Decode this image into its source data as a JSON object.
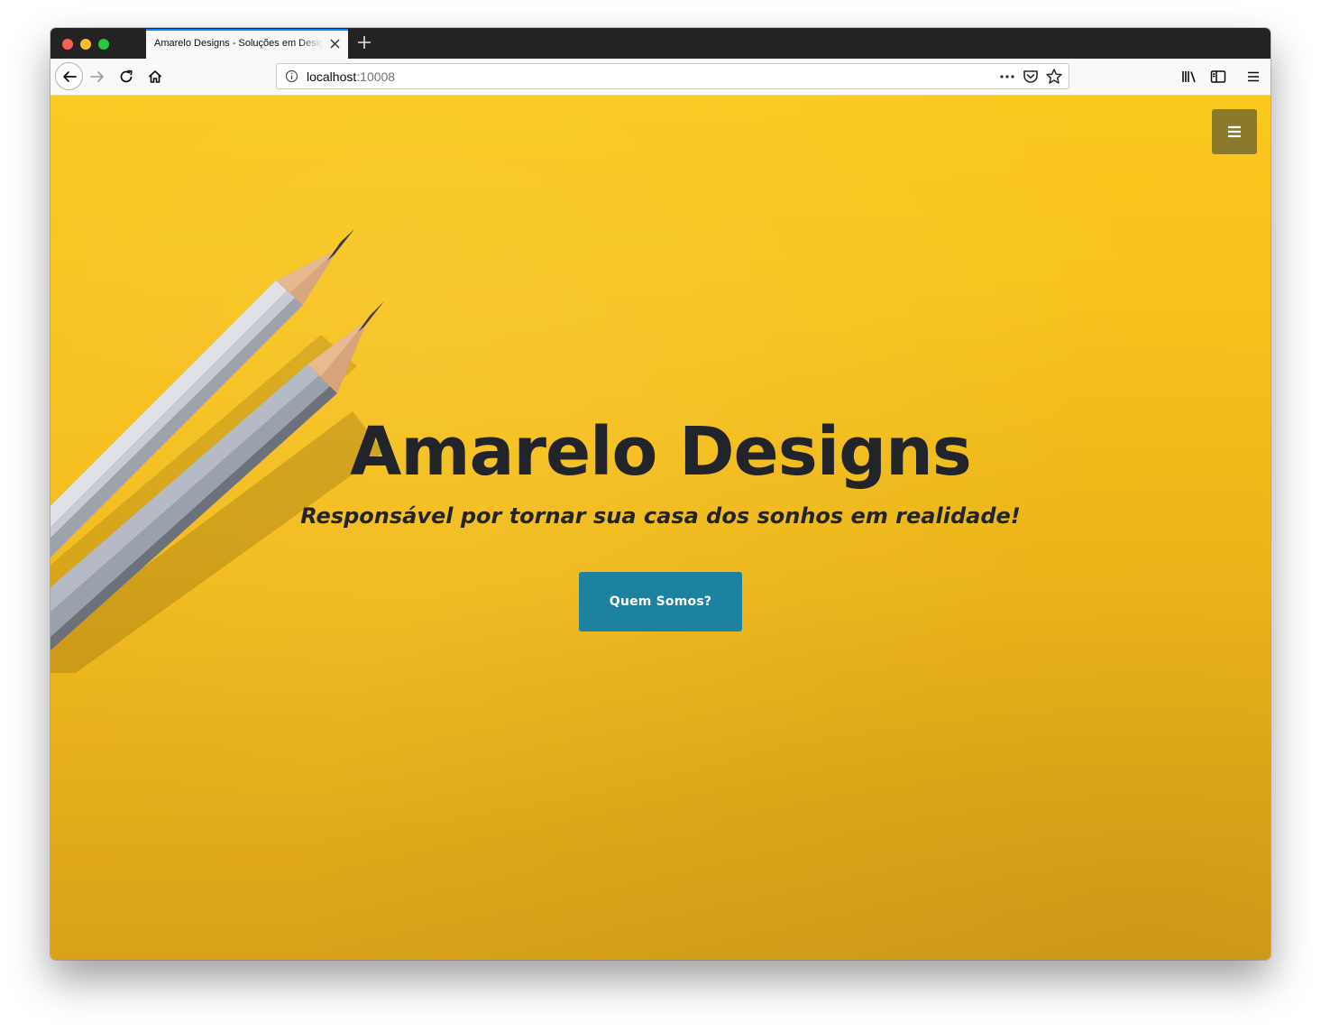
{
  "browser": {
    "tab_title": "Amarelo Designs - Soluções em Design",
    "url_host": "localhost",
    "url_port": ":10008"
  },
  "page": {
    "title": "Amarelo Designs",
    "subtitle": "Responsável por tornar sua casa dos sonhos em realidade!",
    "cta_label": "Quem Somos?"
  },
  "icons": {
    "nav_toggle": "hamburger-icon",
    "toolbar": [
      "back-arrow-icon",
      "forward-arrow-icon",
      "reload-icon",
      "home-icon",
      "info-icon",
      "more-dots-icon",
      "pocket-icon",
      "bookmark-star-icon",
      "library-icon",
      "sidebar-icon",
      "menu-icon"
    ]
  },
  "colors": {
    "background": "#f9c21c",
    "cta": "#1c82a0",
    "nav_toggle": "#8b7a2b",
    "text": "#212529"
  }
}
